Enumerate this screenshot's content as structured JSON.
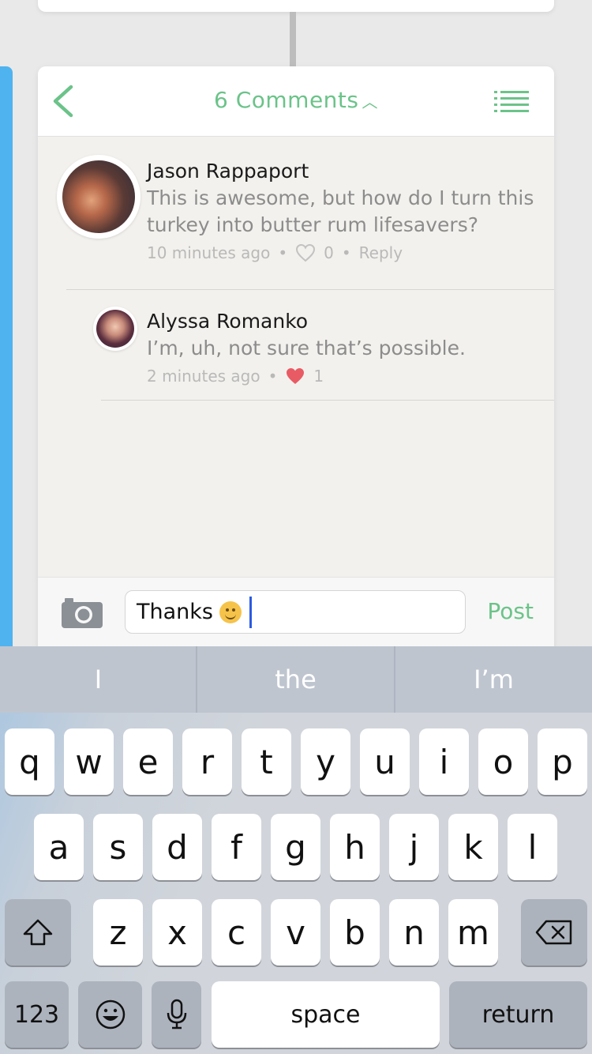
{
  "header": {
    "title": "6 Comments"
  },
  "comments": [
    {
      "author": "Jason Rappaport",
      "text_line1": "This is awesome, but how do I turn this",
      "text_line2": "turkey into butter rum lifesavers?",
      "time": "10 minutes ago",
      "likes": "0",
      "reply_label": "Reply"
    },
    {
      "author": "Alyssa Romanko",
      "text_line1": "I’m, uh, not sure that’s possible.",
      "time": "2 minutes ago",
      "likes": "1"
    }
  ],
  "composer": {
    "value": "Thanks",
    "post_label": "Post"
  },
  "keyboard": {
    "predictions": [
      "I",
      "the",
      "I’m"
    ],
    "row1": [
      "q",
      "w",
      "e",
      "r",
      "t",
      "y",
      "u",
      "i",
      "o",
      "p"
    ],
    "row2": [
      "a",
      "s",
      "d",
      "f",
      "g",
      "h",
      "j",
      "k",
      "l"
    ],
    "row3": [
      "z",
      "x",
      "c",
      "v",
      "b",
      "n",
      "m"
    ],
    "numbers_label": "123",
    "space_label": "space",
    "return_label": "return"
  },
  "colors": {
    "accent": "#6bc389",
    "like": "#e85b64",
    "side_accent": "#4fb3f0"
  }
}
